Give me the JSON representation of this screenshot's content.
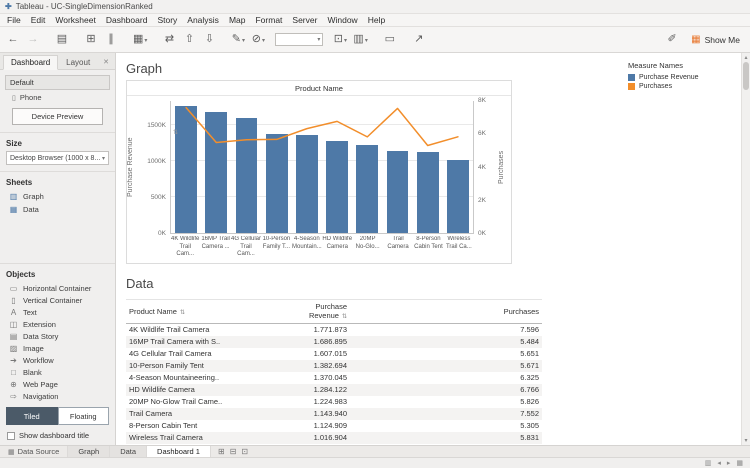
{
  "window": {
    "title": "Tableau - UC-SingleDimensionRanked"
  },
  "menu": {
    "items": [
      "File",
      "Edit",
      "Worksheet",
      "Dashboard",
      "Story",
      "Analysis",
      "Map",
      "Format",
      "Server",
      "Window",
      "Help"
    ]
  },
  "toolbar": {
    "left_icons": [
      {
        "name": "back-arrow-icon",
        "glyph": "←"
      },
      {
        "name": "forward-arrow-icon",
        "glyph": "→",
        "disabled": true
      },
      {
        "name": "save-icon",
        "glyph": "▤",
        "gap": true
      },
      {
        "name": "add-data-source-icon",
        "glyph": "⊞",
        "gap": true
      },
      {
        "name": "pause-updates-icon",
        "glyph": "∥"
      },
      {
        "name": "new-worksheet-icon",
        "glyph": "▦",
        "caret": true,
        "gap": true
      },
      {
        "name": "swap-axes-icon",
        "glyph": "⇄",
        "gap": true
      },
      {
        "name": "sort-ascending-icon",
        "glyph": "⇧"
      },
      {
        "name": "sort-descending-icon",
        "glyph": "⇩"
      },
      {
        "name": "highlight-icon",
        "glyph": "✎",
        "caret": true,
        "gap": true
      },
      {
        "name": "clear-sheet-icon",
        "glyph": "⊘",
        "caret": true
      }
    ],
    "right_icons": [
      {
        "name": "fit-selector-icon",
        "glyph": "⊡",
        "caret": true
      },
      {
        "name": "show-cards-icon",
        "glyph": "▥",
        "caret": true
      },
      {
        "name": "presentation-mode-icon",
        "glyph": "▭",
        "gap": true
      },
      {
        "name": "share-icon",
        "glyph": "↗",
        "gap": true
      }
    ],
    "show_me": "Show Me"
  },
  "sidebar": {
    "tabs": [
      {
        "label": "Dashboard",
        "active": true
      },
      {
        "label": "Layout",
        "active": false
      }
    ],
    "default_item": "Default",
    "phone_item": "Phone",
    "device_preview_button": "Device Preview",
    "size_label": "Size",
    "size_value": "Desktop Browser (1000 x 8...",
    "sheets_label": "Sheets",
    "sheets": [
      {
        "label": "Graph",
        "name": "graph",
        "icon": "▥"
      },
      {
        "label": "Data",
        "name": "data",
        "icon": "▦"
      }
    ],
    "objects_label": "Objects",
    "objects": [
      {
        "label": "Horizontal Container",
        "name": "horizontal-container",
        "icon": "▭"
      },
      {
        "label": "Vertical Container",
        "name": "vertical-container",
        "icon": "▯"
      },
      {
        "label": "Text",
        "name": "text",
        "icon": "A"
      },
      {
        "label": "Extension",
        "name": "extension",
        "icon": "◫"
      },
      {
        "label": "Data Story",
        "name": "data-story",
        "icon": "▤"
      },
      {
        "label": "Image",
        "name": "image",
        "icon": "▨"
      },
      {
        "label": "Workflow",
        "name": "workflow",
        "icon": "➔"
      },
      {
        "label": "Blank",
        "name": "blank",
        "icon": "□"
      },
      {
        "label": "Web Page",
        "name": "web-page",
        "icon": "⊕"
      },
      {
        "label": "Navigation",
        "name": "navigation",
        "icon": "⇨"
      }
    ],
    "tiled_button": "Tiled",
    "floating_button": "Floating",
    "show_title_checkbox": "Show dashboard title"
  },
  "canvas": {
    "graph_heading": "Graph",
    "data_heading": "Data"
  },
  "chart_data": {
    "type": "bar",
    "subtype": "bar-line-combo",
    "title": "Product Name",
    "categories": [
      "4K Wildlife Trail Camera",
      "16MP Trail Camera with S..",
      "4G Cellular Trail Camera",
      "10-Person Family Tent",
      "4-Season Mountaineering..",
      "HD Wildlife Camera",
      "20MP No-Glow Trail Came..",
      "Trail Camera",
      "8-Person Cabin Tent",
      "Wireless Trail Camera"
    ],
    "tick_labels": [
      [
        "4K Wildlife",
        "Trail Cam..."
      ],
      [
        "16MP Trail",
        "Camera ..."
      ],
      [
        "4G Cellular",
        "Trail Cam..."
      ],
      [
        "10-Person",
        "Family T..."
      ],
      [
        "4-Season",
        "Mountain..."
      ],
      [
        "HD Wildlife",
        "Camera"
      ],
      [
        "20MP",
        "No-Glo..."
      ],
      [
        "Trail",
        "Camera"
      ],
      [
        "8-Person",
        "Cabin Tent"
      ],
      [
        "Wireless",
        "Trail Ca..."
      ]
    ],
    "series": [
      {
        "name": "Purchase Revenue",
        "type": "bar",
        "axis": "left",
        "color": "#4e79a7",
        "values": [
          1771873,
          1686895,
          1607015,
          1382694,
          1370045,
          1284122,
          1224983,
          1143940,
          1124909,
          1016904
        ]
      },
      {
        "name": "Purchases",
        "type": "line",
        "axis": "right",
        "color": "#f28e2b",
        "values": [
          7596,
          5484,
          5651,
          5671,
          6325,
          6766,
          5826,
          7552,
          5305,
          5831
        ]
      }
    ],
    "left_axis": {
      "label": "Purchase Revenue",
      "ticks": [
        "0K",
        "500K",
        "1000K",
        "1500K"
      ],
      "tick_values": [
        0,
        500000,
        1000000,
        1500000
      ],
      "min": 0,
      "max": 1840000
    },
    "right_axis": {
      "label": "Purchases",
      "ticks": [
        "0K",
        "2K",
        "4K",
        "6K",
        "8K"
      ],
      "tick_values": [
        0,
        2000,
        4000,
        6000,
        8000
      ],
      "min": 0,
      "max": 8000
    },
    "grid": true,
    "legend_position": "top-right"
  },
  "table": {
    "columns": [
      {
        "label": "Product Name",
        "align": "left",
        "sort_icon": true
      },
      {
        "label": "Purchase Revenue",
        "align": "right",
        "sort_icon": true
      },
      {
        "label": "Purchases",
        "align": "right",
        "sort_icon": false
      }
    ],
    "rows": [
      [
        "4K Wildlife Trail Camera",
        "1.771.873",
        "7.596"
      ],
      [
        "16MP Trail Camera with S..",
        "1.686.895",
        "5.484"
      ],
      [
        "4G Cellular Trail Camera",
        "1.607.015",
        "5.651"
      ],
      [
        "10-Person Family Tent",
        "1.382.694",
        "5.671"
      ],
      [
        "4-Season Mountaineering..",
        "1.370.045",
        "6.325"
      ],
      [
        "HD Wildlife Camera",
        "1.284.122",
        "6.766"
      ],
      [
        "20MP No-Glow Trail Came..",
        "1.224.983",
        "5.826"
      ],
      [
        "Trail Camera",
        "1.143.940",
        "7.552"
      ],
      [
        "8-Person Cabin Tent",
        "1.124.909",
        "5.305"
      ],
      [
        "Wireless Trail Camera",
        "1.016.904",
        "5.831"
      ]
    ]
  },
  "legend": {
    "title": "Measure Names",
    "items": [
      {
        "label": "Purchase Revenue",
        "color": "#4e79a7"
      },
      {
        "label": "Purchases",
        "color": "#f28e2b"
      }
    ]
  },
  "statusbar": {
    "data_source_tab": "Data Source",
    "sheet_tabs": [
      "Graph",
      "Data",
      "Dashboard 1"
    ],
    "active_sheet_tab": "Dashboard 1",
    "new_sheet_icons": [
      {
        "name": "new-worksheet-tab-icon",
        "glyph": "⊞"
      },
      {
        "name": "new-dashboard-tab-icon",
        "glyph": "⊟"
      },
      {
        "name": "new-story-tab-icon",
        "glyph": "⊡"
      }
    ],
    "right_icons": [
      {
        "name": "show-filmstrip-icon",
        "glyph": "▥"
      },
      {
        "name": "previous-sheet-icon",
        "glyph": "◂"
      },
      {
        "name": "next-sheet-icon",
        "glyph": "▸"
      },
      {
        "name": "sheet-sorter-icon",
        "glyph": "▦"
      }
    ]
  }
}
